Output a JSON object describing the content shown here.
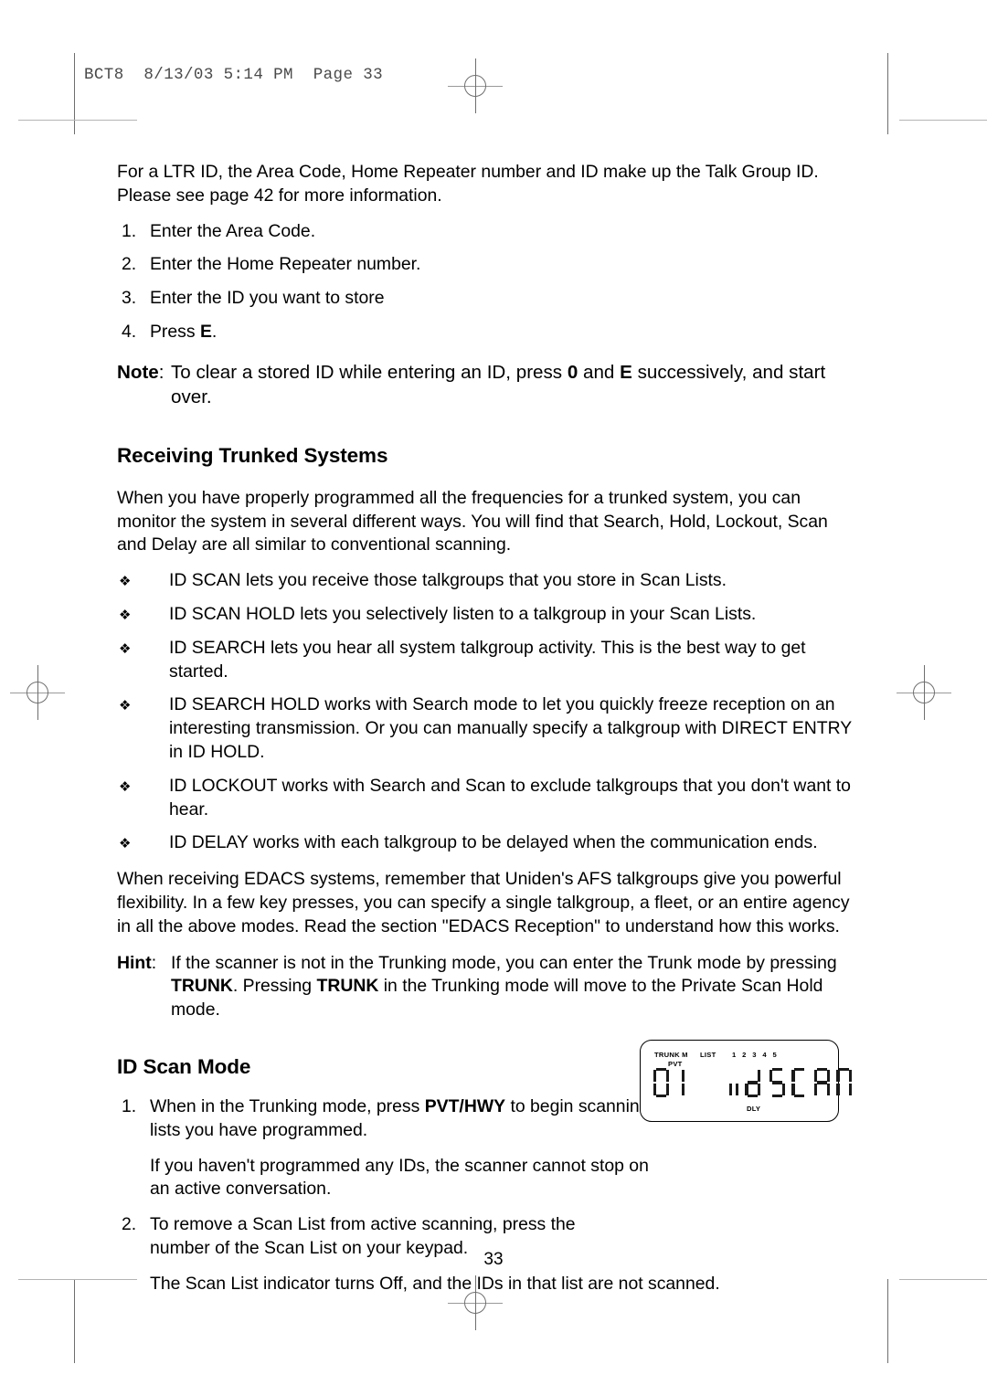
{
  "header": {
    "running_head": "BCT8  8/13/03 5:14 PM  Page 33"
  },
  "body": {
    "intro_para": "For a LTR ID, the Area Code, Home Repeater number and ID make up the Talk Group ID. Please see page 42 for more information.",
    "steps": [
      {
        "num": "1.",
        "text": "Enter the Area Code."
      },
      {
        "num": "2.",
        "text": "Enter the Home Repeater number."
      },
      {
        "num": "3.",
        "text": "Enter the ID you want to store"
      },
      {
        "num": "4.",
        "text_before": "Press ",
        "bold": "E",
        "text_after": "."
      }
    ],
    "note": {
      "label": "Note",
      "colon": ":",
      "text_1": "To clear a stored ID while entering an ID, press ",
      "bold_1": "0",
      "text_2": " and ",
      "bold_2": "E",
      "text_3": " successively, and start over."
    }
  },
  "section_trunked": {
    "heading": "Receiving Trunked Systems",
    "para": "When you have properly programmed all the frequencies for a trunked system, you can monitor the system in several different ways. You will find that Search, Hold, Lockout, Scan and Delay are all similar to conventional scanning.",
    "bullet_glyph": "❖",
    "bullets": [
      "ID SCAN lets you receive those talkgroups that you store in Scan Lists.",
      "ID SCAN HOLD lets you selectively listen to a talkgroup in your Scan Lists.",
      "ID SEARCH lets you hear all system talkgroup activity. This is the best way to get started.",
      "ID SEARCH HOLD works with Search mode to let you quickly freeze reception on an interesting transmission. Or you can manually specify a talkgroup with DIRECT ENTRY in ID HOLD.",
      "ID LOCKOUT works with Search and Scan to exclude talkgroups that you don't want to hear.",
      "ID DELAY works with each talkgroup to be delayed when the communication ends."
    ],
    "edacs_para": "When receiving EDACS systems, remember that Uniden's AFS talkgroups give you powerful flexibility. In a few key presses, you can specify a single talkgroup, a fleet, or an entire agency in all the above modes. Read the section \"EDACS Reception\" to understand how this works.",
    "hint": {
      "label": "Hint",
      "colon": ":",
      "text_1": "If the scanner is not in the Trunking mode, you can enter the Trunk mode by pressing ",
      "bold_1": "TRUNK",
      "text_2": ". Pressing ",
      "bold_2": "TRUNK",
      "text_3": " in the Trunking mode will move to the Private Scan Hold mode."
    }
  },
  "section_id_scan": {
    "heading": "ID Scan Mode",
    "step1": {
      "num": "1.",
      "text_1": "When in the Trunking mode, press ",
      "bold_1": "PVT/HWY",
      "text_2": " to begin scanning the lists you have programmed."
    },
    "step1_note": "If you haven't programmed any IDs, the scanner cannot stop on an active conversation.",
    "step2": {
      "num": "2.",
      "text": "To remove a Scan List from active scanning, press the number of the Scan List on your keypad."
    },
    "step2_note": "The Scan List indicator turns Off, and the IDs in that list are not scanned."
  },
  "lcd_display": {
    "annunciator_trunk": "TRUNK M",
    "annunciator_pvt": "PVT",
    "annunciator_list": "LIST",
    "annunciator_list_numbers": "1 2 3 4 5",
    "annunciator_dly": "DLY",
    "segment_channel": "01",
    "segment_mode": "id",
    "segment_status": "SCAN",
    "border_color": "#000000",
    "segment_color": "#1a1a1a"
  },
  "footer": {
    "page_number": "33"
  }
}
